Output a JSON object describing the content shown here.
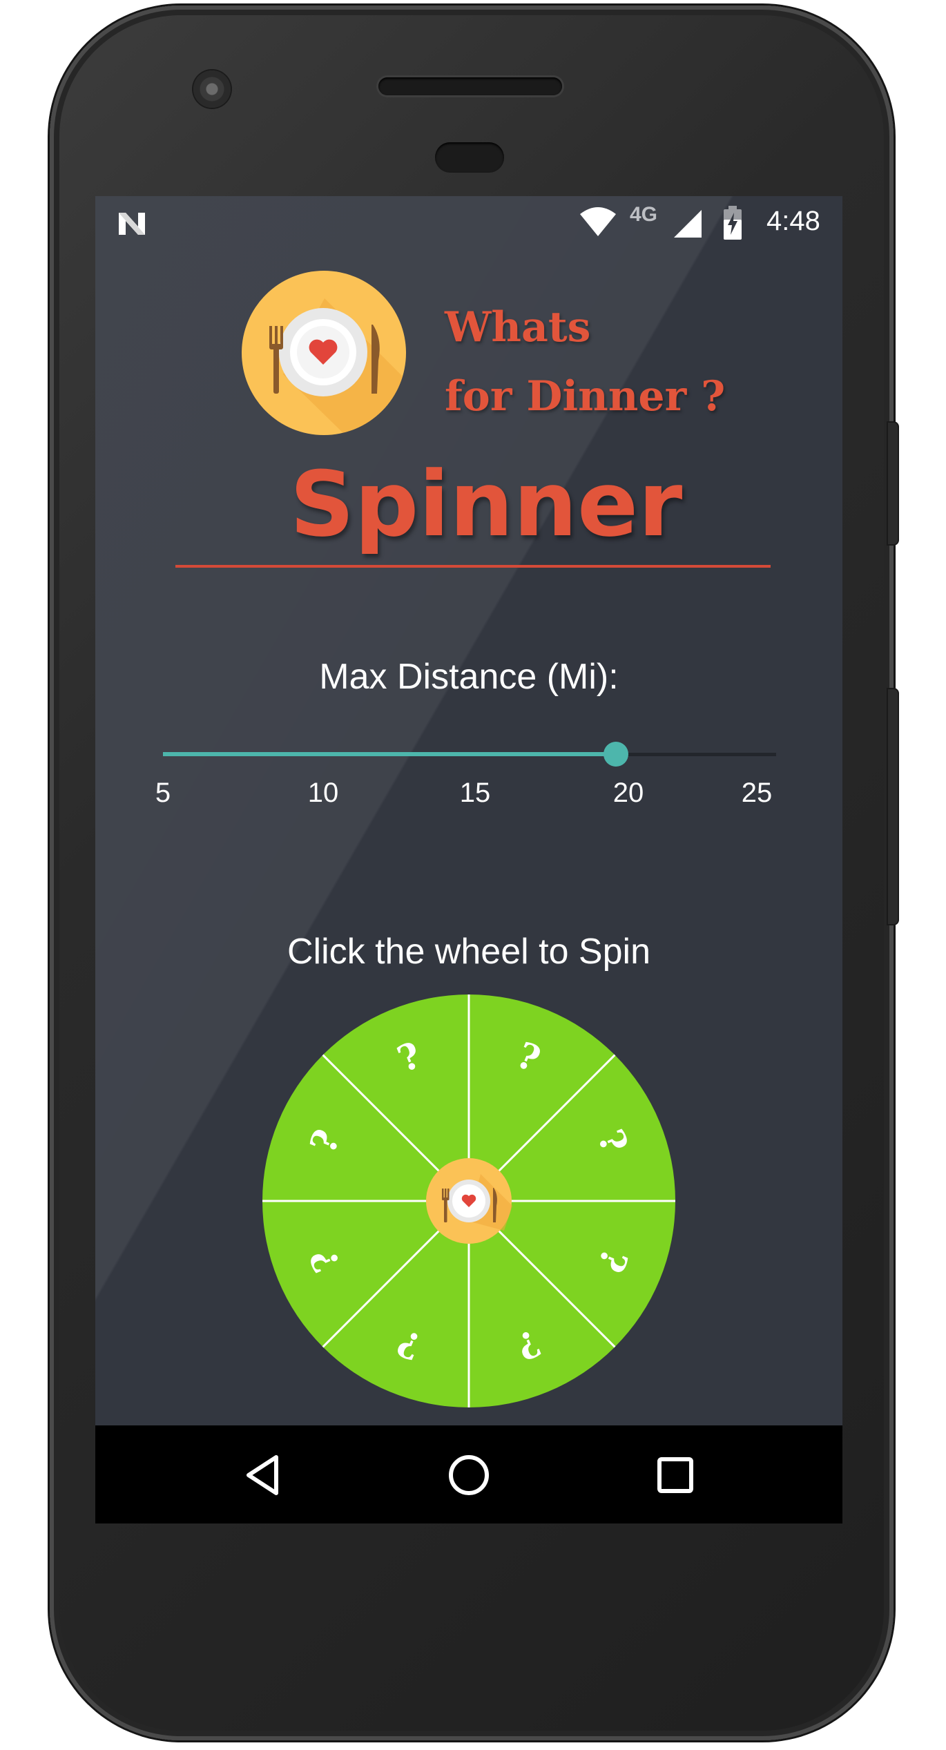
{
  "status_bar": {
    "notification_icon": "n-logo-icon",
    "wifi_icon": "wifi-icon",
    "network_type": "4G",
    "signal_icon": "cell-signal-icon",
    "battery_icon": "battery-charging-icon",
    "time": "4:48"
  },
  "header": {
    "logo_icon": "plate-fork-knife-heart-icon",
    "tagline_line1": "Whats",
    "tagline_line2": "for Dinner ?",
    "title": "Spinner"
  },
  "distance": {
    "label": "Max Distance (Mi):",
    "min": 5,
    "max": 25,
    "value": 20,
    "ticks": [
      "5",
      "10",
      "15",
      "20",
      "25"
    ]
  },
  "wheel": {
    "instruction": "Click the wheel to Spin",
    "segment_count": 8,
    "segment_symbol": "?",
    "center_icon": "plate-fork-knife-heart-icon"
  },
  "nav_bar": {
    "back_icon": "back-triangle-icon",
    "home_icon": "home-circle-icon",
    "recents_icon": "recents-square-icon"
  },
  "colors": {
    "background": "#333740",
    "accent_red": "#e2553b",
    "slider_teal": "#4db6ac",
    "wheel_green": "#7ed321",
    "logo_yellow": "#fbc256"
  }
}
